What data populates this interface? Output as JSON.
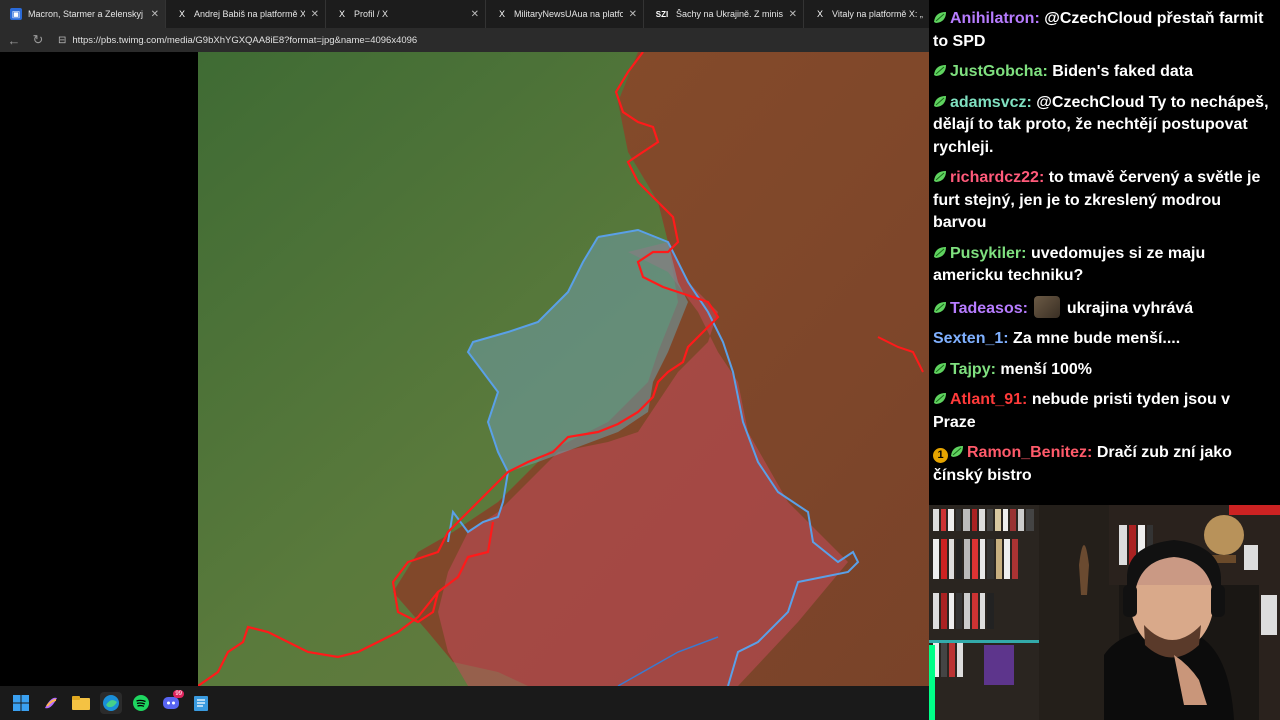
{
  "browser": {
    "tabs": [
      {
        "label": "Macron, Starmer a Zelenskyj pode",
        "icon": "news-favicon",
        "active": true
      },
      {
        "label": "Andrej Babiš na platformě X: „Dne",
        "icon": "x-favicon",
        "active": false
      },
      {
        "label": "Profil / X",
        "icon": "x-favicon",
        "active": false
      },
      {
        "label": "MilitaryNewsUAua na platforme",
        "icon": "x-favicon",
        "active": false
      },
      {
        "label": "Šachy na Ukrajině. Z ministra obra",
        "icon": "szi-favicon",
        "active": false
      },
      {
        "label": "Vitaly na platformě X: „The gla",
        "icon": "x-favicon",
        "active": false
      }
    ],
    "tab_close_glyph": "✕",
    "szi_label": "SZI",
    "x_glyph": "X",
    "url": "https://pbs.twimg.com/media/G9bXhYGXQAA8iE8?format=jpg&name=4096x4096"
  },
  "map": {
    "colors": {
      "ukraine_green": "#4a6b35",
      "occupied_brown": "#8a4a2a",
      "frontline": "#ff1a1a",
      "oblast_border": "#5aa0e8",
      "blue_area": "#6c9aa0",
      "red_area": "#c24a5a"
    }
  },
  "chat": {
    "messages": [
      {
        "user": "Anihilatron",
        "color": "#b77cff",
        "badge": "leaf-badge",
        "text": "@CzechCloud přestaň farmit to SPD"
      },
      {
        "user": "JustGobcha",
        "color": "#7fe07f",
        "badge": "leaf-badge",
        "text": "Biden's faked data"
      },
      {
        "user": "adamsvcz",
        "color": "#7fe0c0",
        "badge": "leaf-badge",
        "text": "@CzechCloud Ty to nechápeš, dělají to tak proto, že nechtějí postupovat rychleji."
      },
      {
        "user": "richardcz22",
        "color": "#ff5a7a",
        "badge": "leaf-badge",
        "text": "to tmavě červený a světle je furt stejný, jen je to zkreslený modrou barvou"
      },
      {
        "user": "Pusykiler",
        "color": "#7fe07f",
        "badge": "leaf-badge",
        "text": "uvedomujes si ze maju americku techniku?"
      },
      {
        "user": "Tadeasos",
        "color": "#b77cff",
        "badge": "leaf-badge",
        "emote": "bear-emote",
        "text": "ukrajina vyhrává"
      },
      {
        "user": "Sexten_1",
        "color": "#7fb0ff",
        "badge": "",
        "text": "Za mne bude menší...."
      },
      {
        "user": "Tajpy",
        "color": "#7fe07f",
        "badge": "leaf-badge",
        "text": "menší 100%"
      },
      {
        "user": "Atlant_91",
        "color": "#ff3a3a",
        "badge": "leaf-badge",
        "text": "nebude pristi tyden jsou v Praze"
      },
      {
        "user": "Ramon_Benitez",
        "color": "#ff5a6a",
        "badge": "leaf-badge",
        "coin": "1",
        "text": "Dračí zub zní jako čínský bistro"
      }
    ],
    "separator": ":"
  },
  "taskbar": {
    "items": [
      "windows-start-icon",
      "copilot-icon",
      "file-explorer-icon",
      "edge-icon",
      "spotify-icon",
      "discord-icon",
      "notepad-icon"
    ],
    "discord_badge": "99"
  }
}
